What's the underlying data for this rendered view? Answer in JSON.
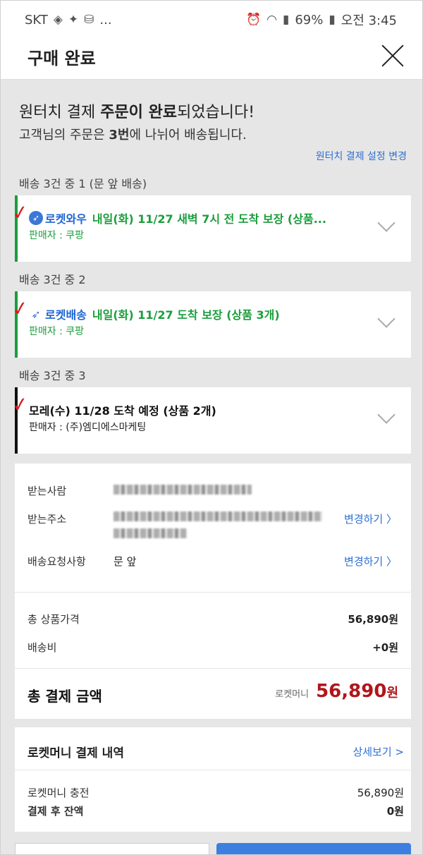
{
  "status_bar": {
    "carrier": "SKT",
    "left_icons": [
      "pill-icon",
      "twitter-icon",
      "db-icon"
    ],
    "more": "...",
    "battery": "69%",
    "time": "오전 3:45"
  },
  "header": {
    "title": "구매 완료"
  },
  "complete": {
    "title_a": "원터치 결제 ",
    "title_b": "주문이 완료",
    "title_c": "되었습니다!",
    "sub_a": "고객님의 주문은 ",
    "sub_b": "3번",
    "sub_c": "에 나뉘어 배송됩니다.",
    "settings_link": "원터치 결제 설정 변경"
  },
  "shipments": [
    {
      "group_label": "배송 3건 중 1 (문 앞 배송)",
      "badge": "로켓와우",
      "eta": "내일(화) 11/27 새벽 7시 전 도착 보장 (상품...",
      "seller": "판매자 : 쿠팡"
    },
    {
      "group_label": "배송 3건 중 2",
      "badge": "로켓배송",
      "eta": "내일(화) 11/27 도착 보장 (상품 3개)",
      "seller": "판매자 : 쿠팡"
    },
    {
      "group_label": "배송 3건 중 3",
      "badge": "",
      "eta": "모레(수) 11/28 도착 예정 (상품 2개)",
      "seller": "판매자 : (주)엠디에스마케팅"
    }
  ],
  "delivery": {
    "recipient_label": "받는사람",
    "address_label": "받는주소",
    "request_label": "배송요청사항",
    "request_value": "문 앞",
    "change_label": "변경하기 〉"
  },
  "pricing": {
    "items_label": "총 상품가격",
    "items_value": "56,890원",
    "shipping_label": "배송비",
    "shipping_value": "+0원",
    "total_label": "총 결제 금액",
    "total_method": "로켓머니",
    "total_amount": "56,890",
    "total_unit": "원"
  },
  "rocket_money": {
    "title": "로켓머니 결제 내역",
    "detail_link": "상세보기 >",
    "charge_label": "로켓머니 충전",
    "charge_value": "56,890원",
    "balance_label": "결제 후 잔액",
    "balance_value": "0원"
  },
  "colors": {
    "green": "#1a9e3c",
    "blue": "#2e6fd1",
    "red": "#b0161b"
  }
}
